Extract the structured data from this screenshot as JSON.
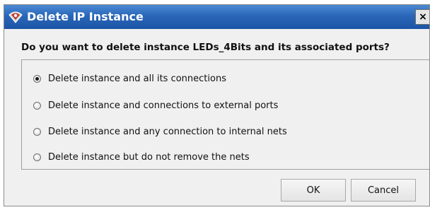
{
  "window": {
    "title": "Delete IP Instance",
    "close_label": "×"
  },
  "dialog": {
    "question": "Do you want to delete instance LEDs_4Bits and its associated ports?",
    "options": [
      {
        "label": "Delete instance and all its connections",
        "selected": true
      },
      {
        "label": "Delete instance and connections to external ports",
        "selected": false
      },
      {
        "label": "Delete instance and any connection to internal nets",
        "selected": false
      },
      {
        "label": "Delete instance but do not remove the nets",
        "selected": false
      }
    ]
  },
  "buttons": {
    "ok_label": "OK",
    "cancel_label": "Cancel"
  },
  "colors": {
    "titlebar": "#2a66b8",
    "dialog_bg": "#f0f0f0"
  },
  "icons": {
    "app": "xilinx-ip-icon",
    "close": "close-icon"
  }
}
